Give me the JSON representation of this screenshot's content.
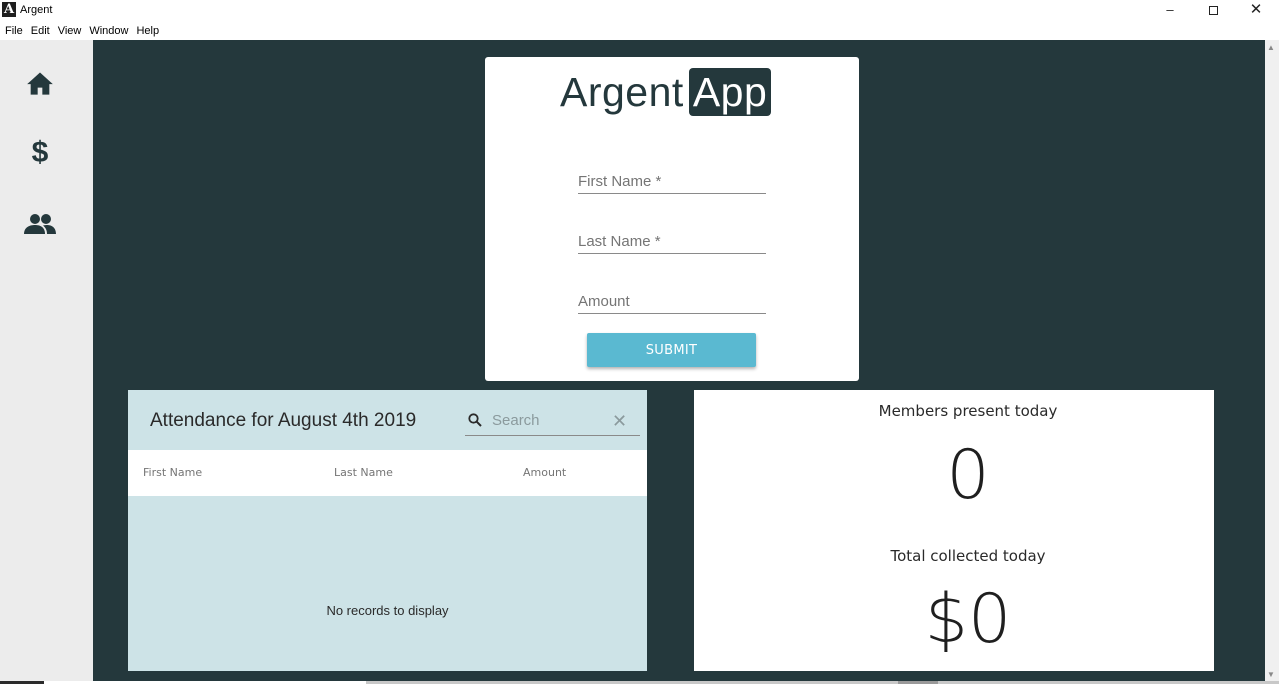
{
  "window": {
    "title": "Argent",
    "logo_letter": "A",
    "minimize_glyph": "–",
    "close_glyph": "✕"
  },
  "menu": [
    "File",
    "Edit",
    "View",
    "Window",
    "Help"
  ],
  "sidebar": {
    "items": [
      {
        "name": "home-icon"
      },
      {
        "name": "dollar-icon",
        "glyph": "$"
      },
      {
        "name": "people-icon"
      }
    ]
  },
  "form": {
    "brand_left": "Argent",
    "brand_right": "App",
    "first_name_label": "First Name *",
    "last_name_label": "Last Name *",
    "amount_label": "Amount",
    "submit_label": "SUBMIT"
  },
  "attendance": {
    "title": "Attendance for August 4th 2019",
    "search_placeholder": "Search",
    "clear_glyph": "✕",
    "columns": [
      "First Name",
      "Last Name",
      "Amount"
    ],
    "rows": [],
    "empty_message": "No records to display"
  },
  "stats": {
    "members_label": "Members present today",
    "members_value": "0",
    "collected_label": "Total collected today",
    "collected_value": "$0"
  },
  "colors": {
    "main_bg": "#24383c",
    "sidebar_bg": "#ececec",
    "submit_bg": "#5ab9d1",
    "table_bg": "#cde3e7"
  }
}
